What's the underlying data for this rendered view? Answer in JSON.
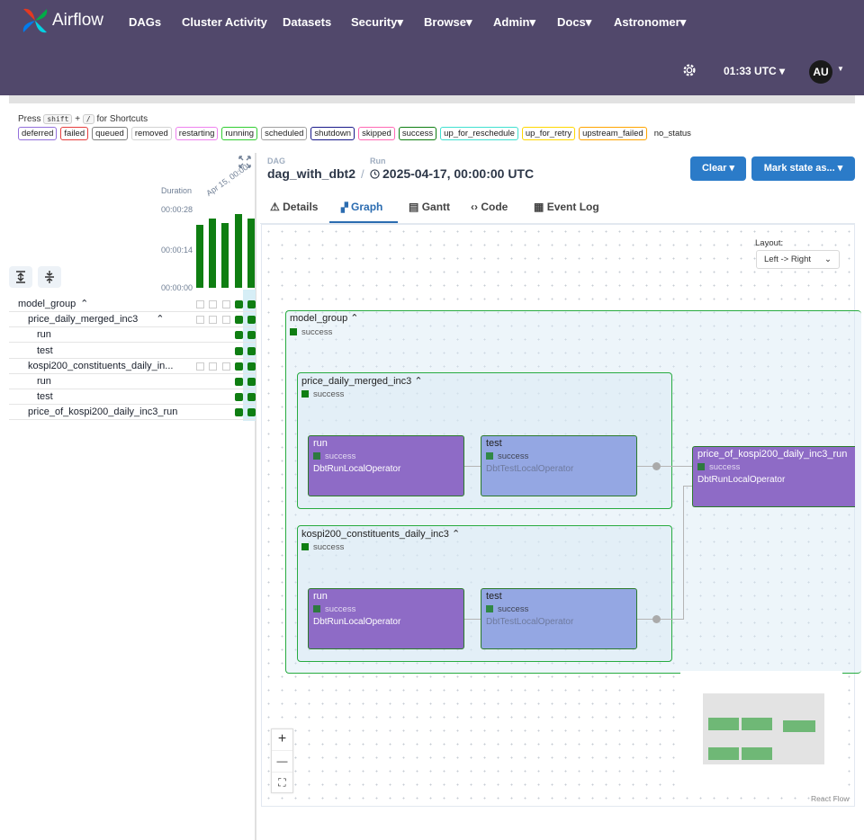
{
  "brand": "Airflow",
  "nav": [
    "DAGs",
    "Cluster Activity",
    "Datasets",
    "Security",
    "Browse",
    "Admin",
    "Docs",
    "Astronomer"
  ],
  "time": "01:33 UTC",
  "user_initials": "AU",
  "shortcuts": {
    "press": "Press",
    "key1": "shift",
    "plus": "+",
    "key2": "/",
    "suffix": "for Shortcuts"
  },
  "legend": [
    {
      "label": "deferred",
      "color": "#9370db"
    },
    {
      "label": "failed",
      "color": "#e53e3e"
    },
    {
      "label": "queued",
      "color": "#808080"
    },
    {
      "label": "removed",
      "color": "#d3d3d3"
    },
    {
      "label": "restarting",
      "color": "#ee82ee"
    },
    {
      "label": "running",
      "color": "#32cd32"
    },
    {
      "label": "scheduled",
      "color": "#a0a0a0"
    },
    {
      "label": "shutdown",
      "color": "#1a1a8a"
    },
    {
      "label": "skipped",
      "color": "#ff69b4"
    },
    {
      "label": "success",
      "color": "#0f7e12"
    },
    {
      "label": "up_for_reschedule",
      "color": "#40e0d0"
    },
    {
      "label": "up_for_retry",
      "color": "#ffd700"
    },
    {
      "label": "upstream_failed",
      "color": "#ffa500"
    },
    {
      "label": "no_status",
      "color": "#ffffff"
    }
  ],
  "duration": {
    "label": "Duration",
    "ticks": [
      "00:00:28",
      "00:00:14",
      "00:00:00"
    ],
    "date_label": "Apr 15, 00:00",
    "bars": [
      0.8,
      0.88,
      0.82,
      0.93,
      0.88
    ]
  },
  "tree": [
    {
      "label": "model_group",
      "caret": "^",
      "level": 0
    },
    {
      "label": "price_daily_merged_inc3",
      "caret": "^",
      "level": 1
    },
    {
      "label": "run",
      "caret": "",
      "level": 2
    },
    {
      "label": "test",
      "caret": "",
      "level": 2
    },
    {
      "label": "kospi200_constituents_daily_in...",
      "caret": "",
      "level": 1
    },
    {
      "label": "run",
      "caret": "",
      "level": 2
    },
    {
      "label": "test",
      "caret": "",
      "level": 2
    },
    {
      "label": "price_of_kospi200_daily_inc3_run",
      "caret": "",
      "level": 1
    }
  ],
  "header": {
    "dag_label": "DAG",
    "dag_name": "dag_with_dbt2",
    "run_label": "Run",
    "run_date": "2025-04-17, 00:00:00 UTC",
    "clear": "Clear",
    "mark_state": "Mark state as..."
  },
  "tabs": [
    "Details",
    "Graph",
    "Gantt",
    "Code",
    "Event Log"
  ],
  "active_tab": "Graph",
  "layout": {
    "label": "Layout:",
    "value": "Left -> Right"
  },
  "graph": {
    "model_group": {
      "title": "model_group",
      "status": "success"
    },
    "price_group": {
      "title": "price_daily_merged_inc3",
      "status": "success"
    },
    "kospi_group": {
      "title": "kospi200_constituents_daily_inc3",
      "status": "success"
    },
    "tasks": {
      "p_run": {
        "name": "run",
        "status": "success",
        "operator": "DbtRunLocalOperator"
      },
      "p_test": {
        "name": "test",
        "status": "success",
        "operator": "DbtTestLocalOperator"
      },
      "k_run": {
        "name": "run",
        "status": "success",
        "operator": "DbtRunLocalOperator"
      },
      "k_test": {
        "name": "test",
        "status": "success",
        "operator": "DbtTestLocalOperator"
      },
      "final": {
        "name": "price_of_kospi200_daily_inc3_run",
        "status": "success",
        "operator": "DbtRunLocalOperator"
      }
    }
  },
  "zoom": {
    "in": "+",
    "out": "—",
    "fit": "⛶"
  },
  "react_flow": "React Flow"
}
